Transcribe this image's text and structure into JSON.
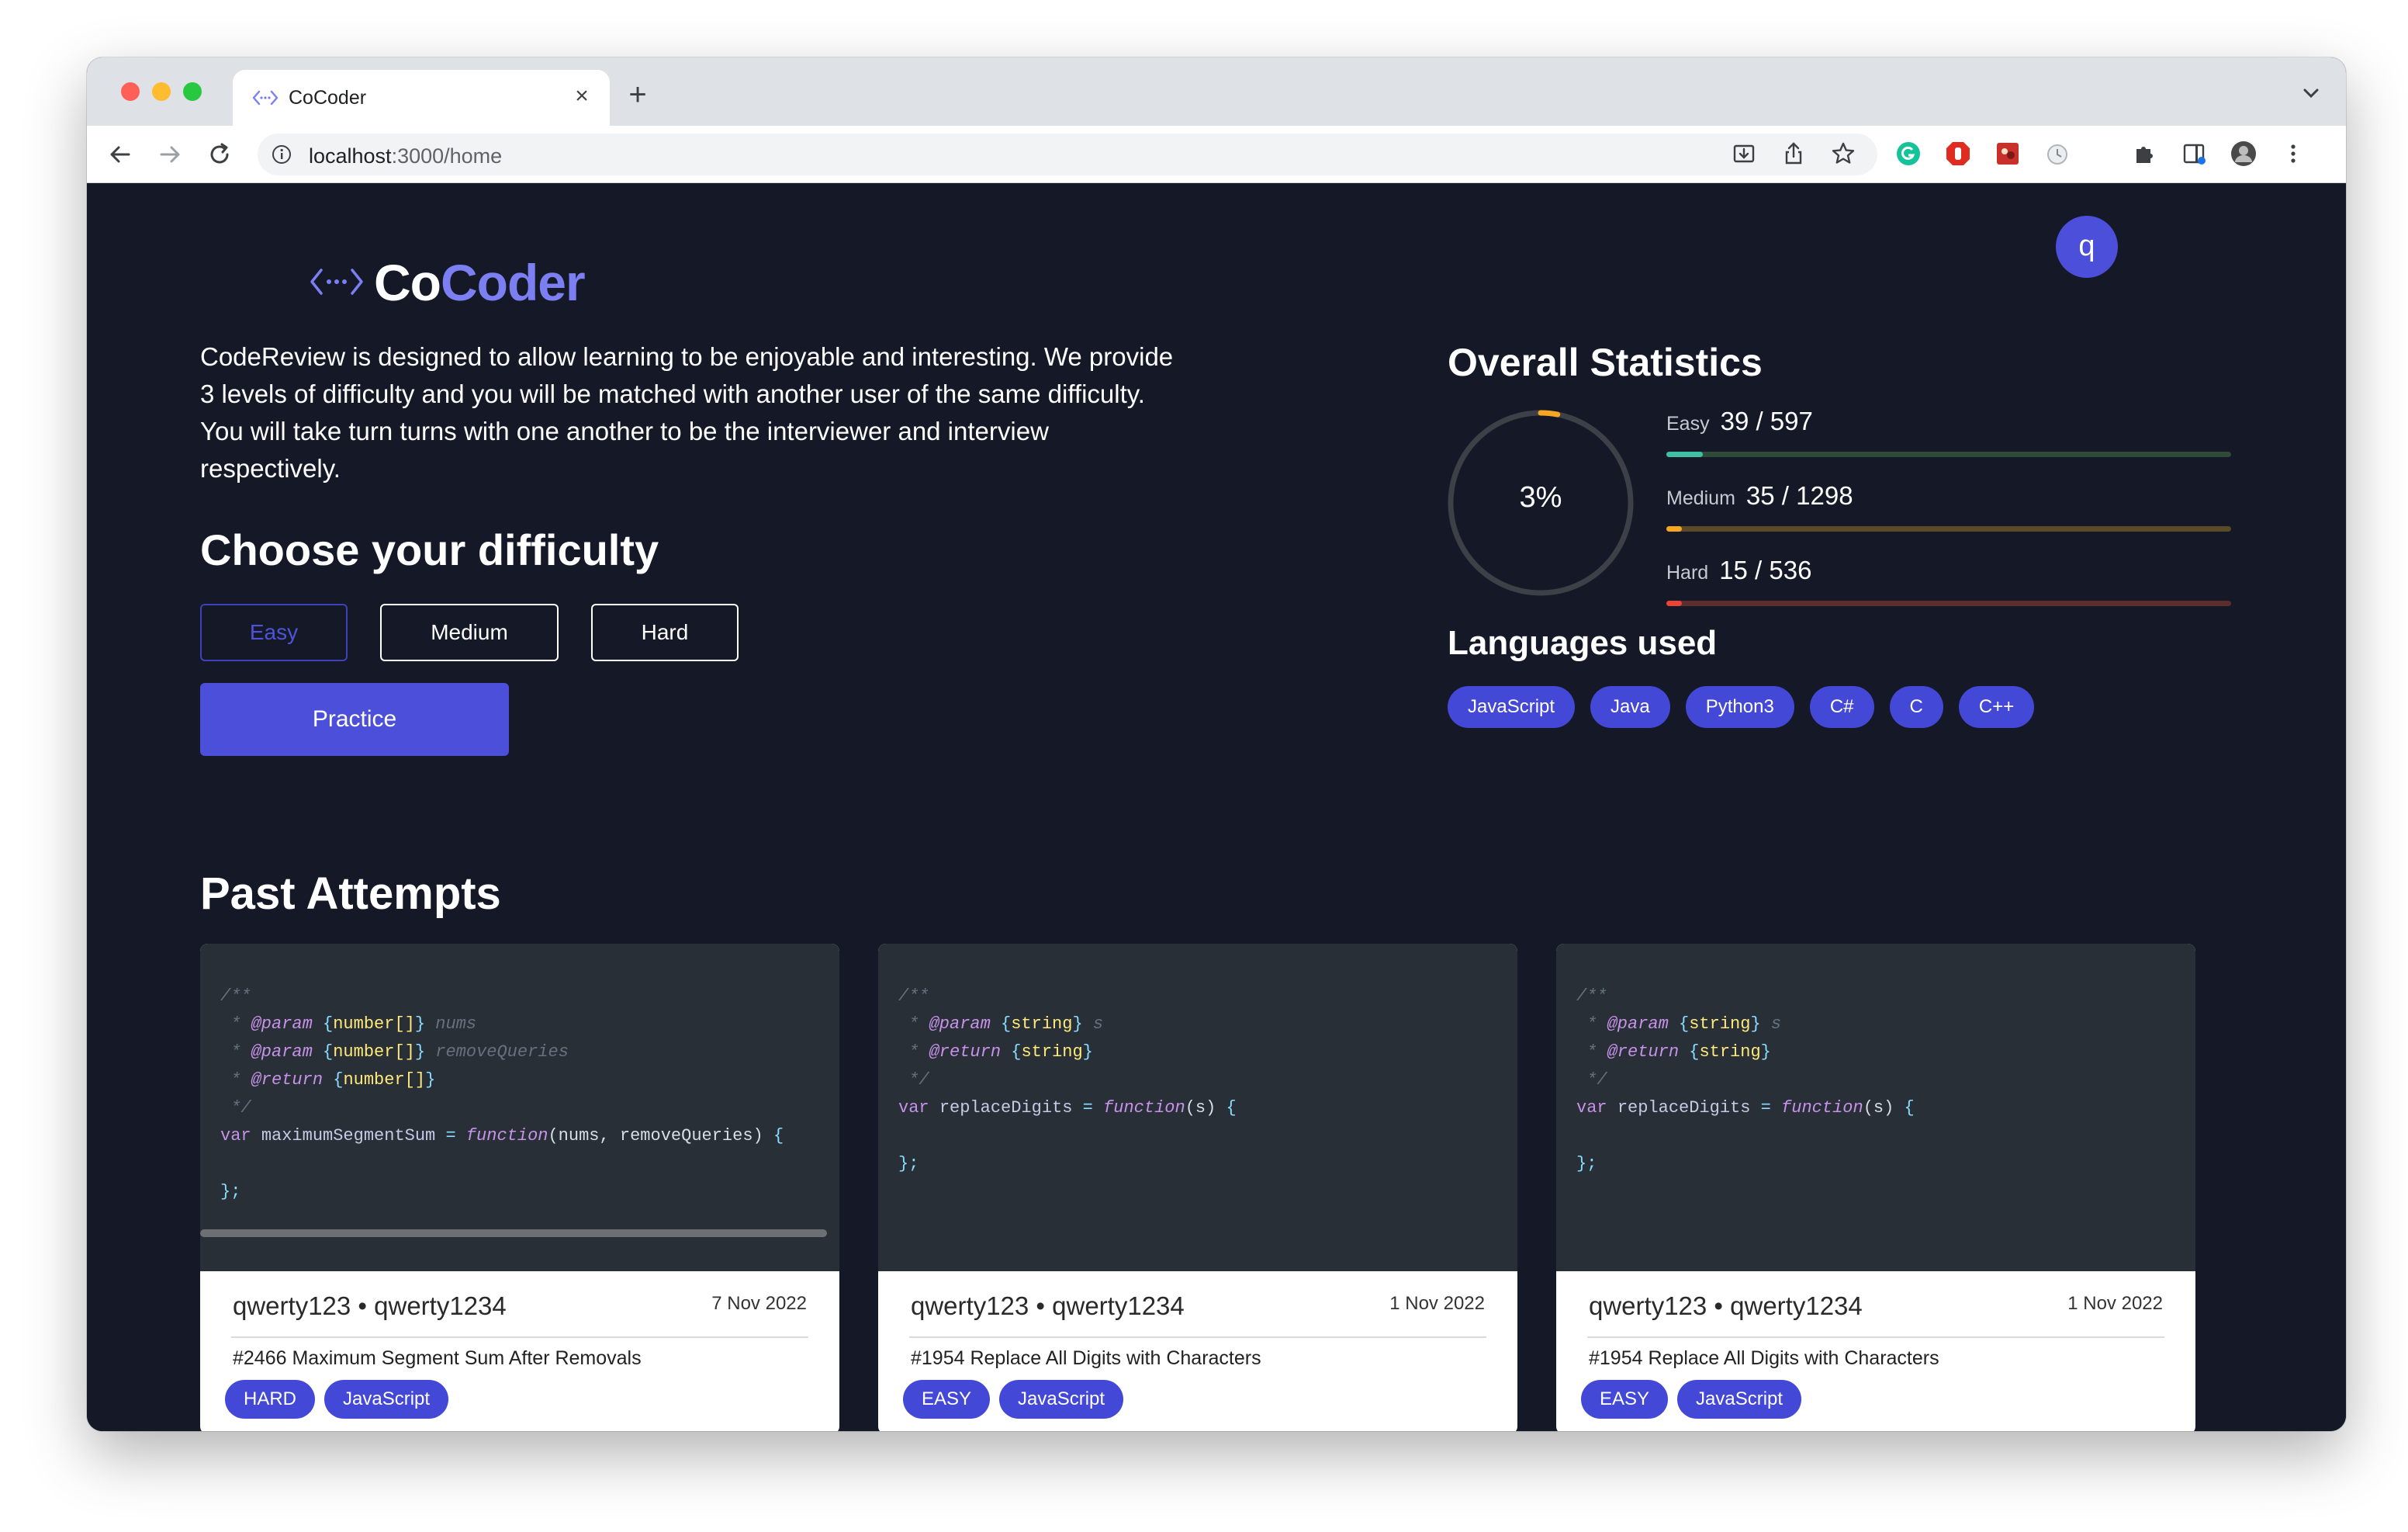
{
  "browser": {
    "tab_title": "CoCoder",
    "new_tab_symbol": "+",
    "close_symbol": "×",
    "url_host": "localhost",
    "url_path": ":3000/home"
  },
  "header": {
    "avatar_letter": "q",
    "logo_part1": "Co",
    "logo_part2": "Coder"
  },
  "intro": "CodeReview is designed to allow learning to be enjoyable and interesting. We provide 3 levels of difficulty and you will be matched with another user of the same difficulty. You will take turn turns with one another to be the interviewer and interview respectively.",
  "difficulty": {
    "heading": "Choose your difficulty",
    "options": [
      "Easy",
      "Medium",
      "Hard"
    ],
    "selected": "Easy",
    "practice_label": "Practice"
  },
  "stats": {
    "heading": "Overall Statistics",
    "overall_percent": "3%",
    "overall_fraction": 0.03,
    "rows": [
      {
        "label": "Easy",
        "value": "39 / 597",
        "fraction": 0.065,
        "color": "#3fbfa4",
        "track": "#2f4a36"
      },
      {
        "label": "Medium",
        "value": "35 / 1298",
        "fraction": 0.027,
        "color": "#f5a623",
        "track": "#5a4a28"
      },
      {
        "label": "Hard",
        "value": "15 / 536",
        "fraction": 0.028,
        "color": "#e8443a",
        "track": "#5c2d2d"
      }
    ]
  },
  "languages": {
    "heading": "Languages used",
    "items": [
      "JavaScript",
      "Java",
      "Python3",
      "C#",
      "C",
      "C++"
    ]
  },
  "past": {
    "heading": "Past Attempts",
    "attempts": [
      {
        "users": "qwerty123 • qwerty1234",
        "date": "7 Nov 2022",
        "question": "#2466 Maximum Segment Sum After Removals",
        "tags": [
          "HARD",
          "JavaScript"
        ],
        "code": {
          "params": [
            [
              "number[]",
              "nums"
            ],
            [
              "number[]",
              "removeQueries"
            ]
          ],
          "return_type": "number[]",
          "fn_name": "maximumSegmentSum",
          "fn_args": "nums, removeQueries"
        }
      },
      {
        "users": "qwerty123 • qwerty1234",
        "date": "1 Nov 2022",
        "question": "#1954 Replace All Digits with Characters",
        "tags": [
          "EASY",
          "JavaScript"
        ],
        "code": {
          "params": [
            [
              "string",
              "s"
            ]
          ],
          "return_type": "string",
          "fn_name": "replaceDigits",
          "fn_args": "s"
        }
      },
      {
        "users": "qwerty123 • qwerty1234",
        "date": "1 Nov 2022",
        "question": "#1954 Replace All Digits with Characters",
        "tags": [
          "EASY",
          "JavaScript"
        ],
        "code": {
          "params": [
            [
              "string",
              "s"
            ]
          ],
          "return_type": "string",
          "fn_name": "replaceDigits",
          "fn_args": "s"
        }
      }
    ]
  }
}
